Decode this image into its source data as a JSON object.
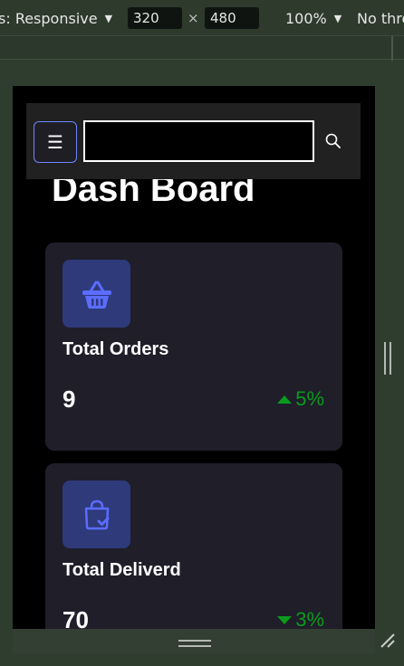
{
  "devtools": {
    "device_label": "s: Responsive",
    "width_value": "320",
    "times": "×",
    "height_value": "480",
    "zoom": "100%",
    "throttle": "No thro"
  },
  "navbar": {
    "menu_glyph": "☰",
    "search_value": "",
    "search_placeholder": ""
  },
  "page": {
    "title": "Dash Board"
  },
  "cards": [
    {
      "label": "Total Orders",
      "value": "9",
      "change": "5%",
      "trend": "up",
      "icon": "basket-icon"
    },
    {
      "label": "Total Deliverd",
      "value": "70",
      "change": "3%",
      "trend": "down",
      "icon": "shopping-bag-check-icon"
    }
  ],
  "colors": {
    "accent": "#5b6cff",
    "icon_bg": "#2e3a7a",
    "card_bg": "#1f1e29",
    "positive": "#0a9b1d"
  }
}
